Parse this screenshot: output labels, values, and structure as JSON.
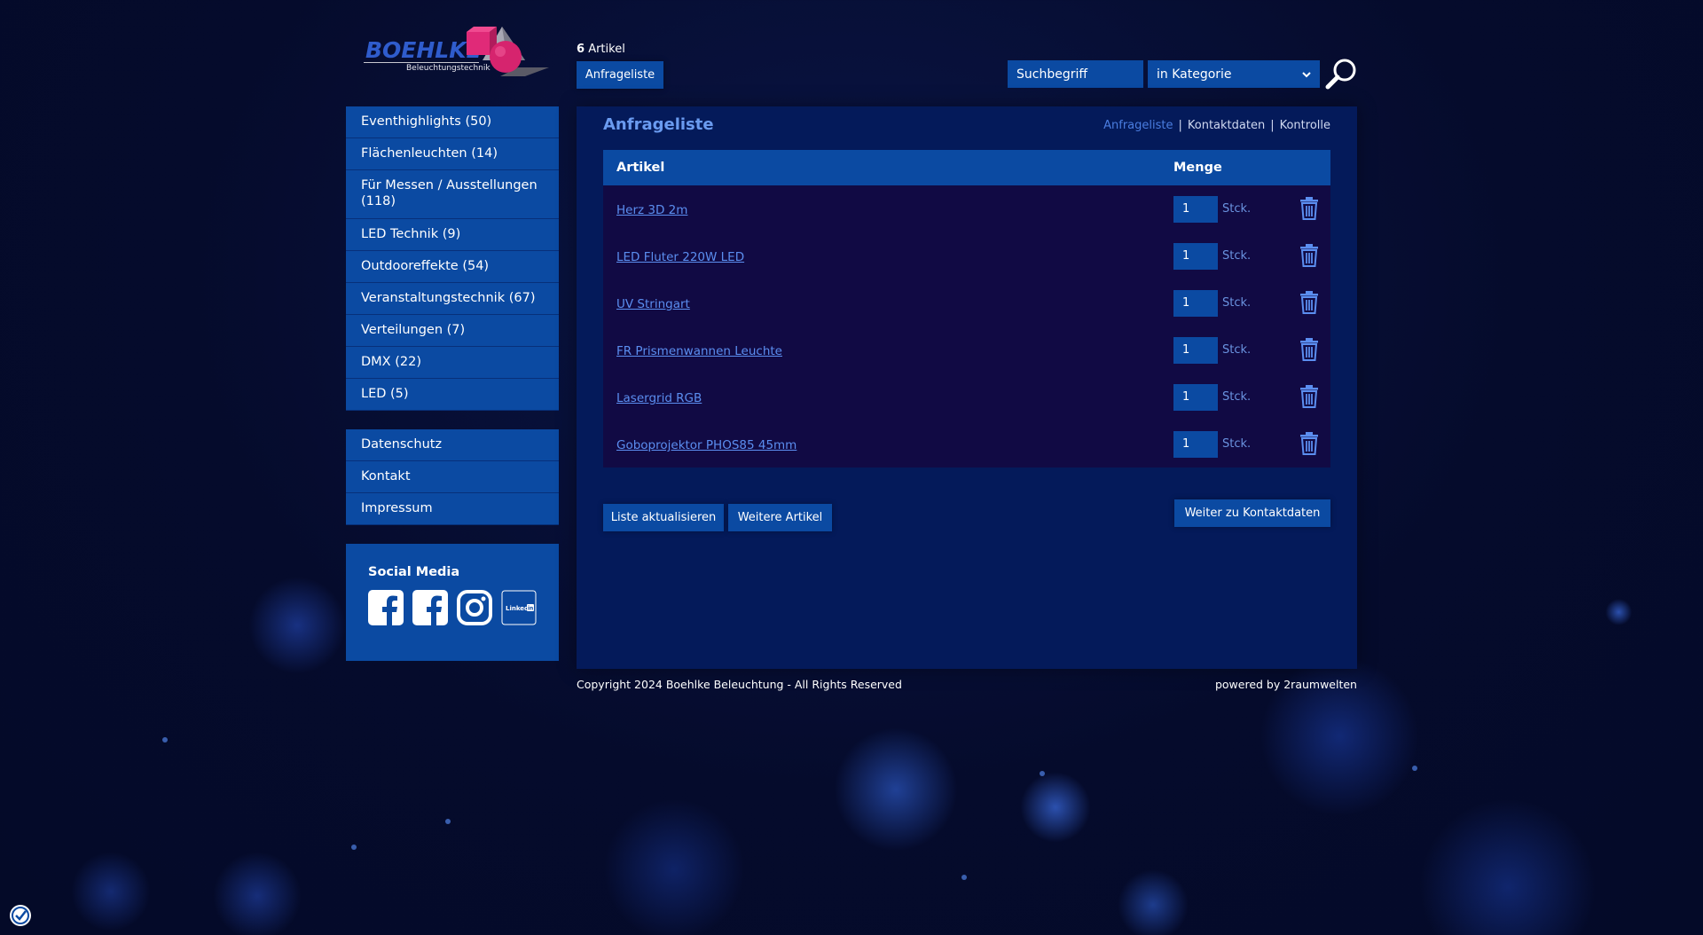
{
  "header": {
    "logo_text": "BOEHLKE",
    "logo_subtext": "Beleuchtungstechnik",
    "cart_count": "6",
    "cart_count_label": "Artikel",
    "anfrage_button": "Anfrageliste",
    "search_placeholder": "Suchbegriff",
    "category_selected": "in Kategorie"
  },
  "sidebar": {
    "categories": [
      {
        "label": "Eventhighlights (50)"
      },
      {
        "label": "Flächenleuchten (14)"
      },
      {
        "label": "Für Messen / Ausstellungen (118)"
      },
      {
        "label": "LED Technik (9)"
      },
      {
        "label": "Outdooreffekte (54)"
      },
      {
        "label": "Veranstaltungstechnik (67)"
      },
      {
        "label": "Verteilungen (7)"
      },
      {
        "label": "DMX (22)"
      },
      {
        "label": "LED (5)"
      }
    ],
    "pages": [
      {
        "label": "Datenschutz"
      },
      {
        "label": "Kontakt"
      },
      {
        "label": "Impressum"
      }
    ],
    "social": {
      "title": "Social Media",
      "icons": [
        "facebook-icon",
        "facebook-icon",
        "instagram-icon",
        "linkedin-icon"
      ],
      "linkedin_text": "Linked"
    }
  },
  "main": {
    "title": "Anfrageliste",
    "steps": [
      "Anfrageliste",
      "Kontaktdaten",
      "Kontrolle"
    ],
    "step_separator": "|",
    "table": {
      "col_article": "Artikel",
      "col_quantity": "Menge",
      "rows": [
        {
          "name": "Herz 3D 2m",
          "qty": "1",
          "unit": "Stck."
        },
        {
          "name": "LED Fluter 220W LED",
          "qty": "1",
          "unit": "Stck."
        },
        {
          "name": "UV Stringart",
          "qty": "1",
          "unit": "Stck."
        },
        {
          "name": "FR Prismenwannen Leuchte",
          "qty": "1",
          "unit": "Stck."
        },
        {
          "name": "Lasergrid RGB",
          "qty": "1",
          "unit": "Stck."
        },
        {
          "name": "Goboprojektor PHOS85 45mm",
          "qty": "1",
          "unit": "Stck."
        }
      ]
    },
    "update_button": "Liste aktualisieren",
    "more_button": "Weitere Artikel",
    "next_button": "Weiter zu Kontaktdaten"
  },
  "footer": {
    "copyright": "Copyright 2024 Boehlke Beleuchtung - All Rights Reserved",
    "powered": "powered by 2raumwelten"
  },
  "colors": {
    "accent": "#0b4aa2",
    "panel": "#041a5a",
    "link": "#5b8ef0",
    "logo_pink": "#d6246e"
  }
}
